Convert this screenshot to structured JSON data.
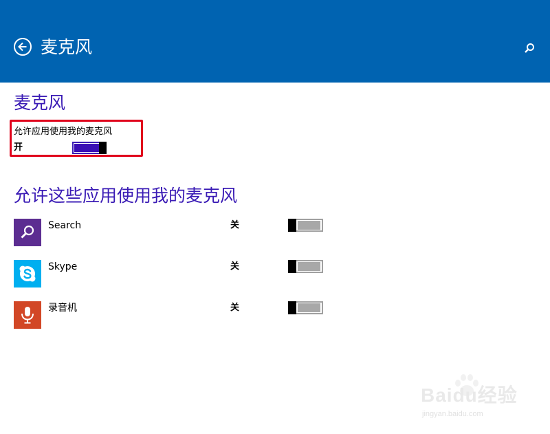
{
  "header": {
    "title": "麦克风",
    "bg_color": "#0063b1"
  },
  "section": {
    "title": "麦克风",
    "color": "#3a1bb5"
  },
  "master": {
    "label": "允许应用使用我的麦克风",
    "state": "开",
    "on": true,
    "highlight_color": "#e0001b"
  },
  "apps": {
    "title": "允许这些应用使用我的麦克风",
    "items": [
      {
        "name": "Search",
        "state": "关",
        "on": false,
        "icon": "search-icon",
        "color": "#5c2d91"
      },
      {
        "name": "Skype",
        "state": "关",
        "on": false,
        "icon": "skype-icon",
        "color": "#00aff0"
      },
      {
        "name": "录音机",
        "state": "关",
        "on": false,
        "icon": "microphone-icon",
        "color": "#d24726"
      }
    ]
  },
  "watermark": {
    "brand": "Baidu经验",
    "url": "jingyan.baidu.com"
  }
}
